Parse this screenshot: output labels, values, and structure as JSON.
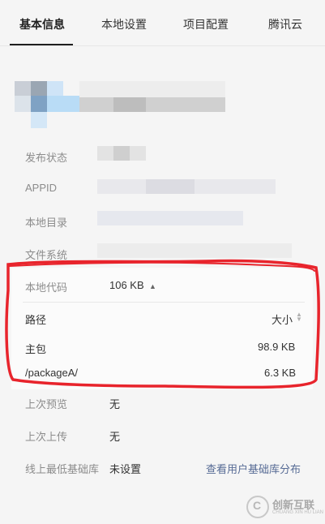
{
  "tabs": [
    {
      "label": "基本信息",
      "active": true
    },
    {
      "label": "本地设置",
      "active": false
    },
    {
      "label": "项目配置",
      "active": false
    },
    {
      "label": "腾讯云",
      "active": false
    }
  ],
  "info": {
    "publish_status_label": "发布状态",
    "appid_label": "APPID",
    "local_dir_label": "本地目录",
    "file_system_label": "文件系统"
  },
  "code": {
    "label": "本地代码",
    "total": "106 KB",
    "header_path": "路径",
    "header_size": "大小",
    "rows": [
      {
        "path": "主包",
        "size": "98.9 KB"
      },
      {
        "path": "/packageA/",
        "size": "6.3 KB"
      }
    ]
  },
  "bottom": {
    "last_preview_label": "上次预览",
    "last_preview_value": "无",
    "last_upload_label": "上次上传",
    "last_upload_value": "无",
    "min_lib_label": "线上最低基础库",
    "min_lib_value": "未设置",
    "lib_link": "查看用户基础库分布"
  },
  "watermark": {
    "text": "创新互联",
    "sub": "CHUANG XIN HU LIAN",
    "logo_glyph": "C"
  },
  "colors": {
    "annotation": "#e8242c",
    "link": "#576b95"
  }
}
